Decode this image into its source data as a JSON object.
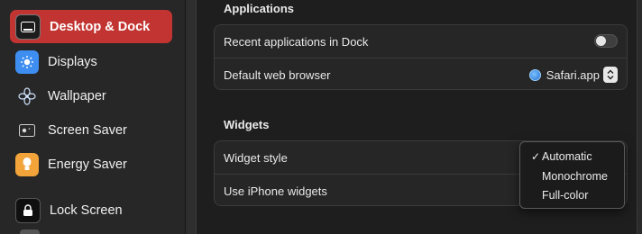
{
  "sidebar": {
    "items": [
      {
        "label": "Desktop & Dock",
        "icon": "desktop-dock-icon",
        "selected": true
      },
      {
        "label": "Displays",
        "icon": "displays-icon",
        "selected": false
      },
      {
        "label": "Wallpaper",
        "icon": "wallpaper-icon",
        "selected": false
      },
      {
        "label": "Screen Saver",
        "icon": "screen-saver-icon",
        "selected": false
      },
      {
        "label": "Energy Saver",
        "icon": "energy-saver-icon",
        "selected": false
      },
      {
        "label": "Lock Screen",
        "icon": "lock-screen-icon",
        "selected": false
      }
    ]
  },
  "applications": {
    "title": "Applications",
    "recent_apps_label": "Recent applications in Dock",
    "recent_apps_enabled": false,
    "default_browser_label": "Default web browser",
    "default_browser_value": "Safari.app"
  },
  "widgets": {
    "title": "Widgets",
    "widget_style_label": "Widget style",
    "use_iphone_label": "Use iPhone widgets"
  },
  "widget_style_menu": {
    "options": [
      "Automatic",
      "Monochrome",
      "Full-color"
    ],
    "selected": "Automatic",
    "check_glyph": "✓"
  },
  "colors": {
    "accent_selected": "#c23431",
    "background": "#1e1e1e",
    "group": "#262626"
  }
}
